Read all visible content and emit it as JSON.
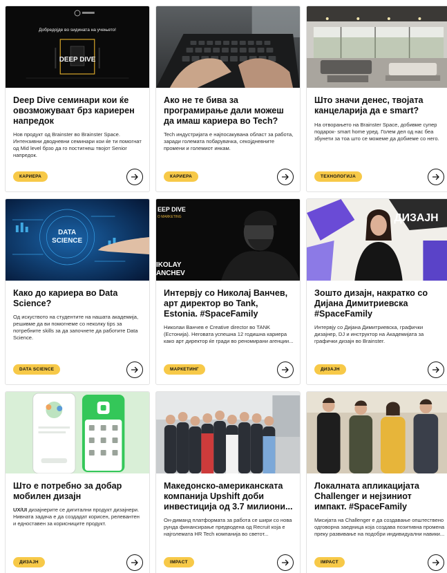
{
  "cards": [
    {
      "title": "Deep Dive семинари кои ќе овозможуваат брз кариерен напредок",
      "desc": "Нов продукт од Brainster во Brainster Space. Интензивни дводневни семинари кои ќе ти помогнат од Mid level брзо да го постигнеш твојот Senior напредок.",
      "badge": "КАРИЕРА",
      "image_text": {
        "welcome": "Добредојде во ѕидината на учењето!",
        "logo": "DEEP DIVE"
      }
    },
    {
      "title": "Ако не те бива за програмирање дали можеш да имаш кариера во Tech?",
      "desc": "Tech индустријата е најпосакувана област за работа, заради големата побарувачка, секојдневните промени и големиот инкам.",
      "badge": "КАРИЕРА"
    },
    {
      "title": "Што значи денес, твојата канцеларија да е smart?",
      "desc": "На отворањето на Brainster Space, добивме супер подарок- smart home уред. Голем дел од нас беа збунети за тоа што се можеме да добиеме со него.",
      "badge": "ТЕХНОЛОГИЈА"
    },
    {
      "title": "Како до кариера во Data Science?",
      "desc": "Од искуството на студентите на нашата академија, решивме да ви помогнеме со неколку tips за потребните skills за да започнете да работите Data Science.",
      "badge": "DATA SCIENCE",
      "image_text": {
        "line1": "DATA",
        "line2": "SCIENCE"
      }
    },
    {
      "title": "Интервју со Николај Ванчев, арт директор во Tank, Estonia. #SpaceFamily",
      "desc": "Николаи Ванчев е Creative director во TANK (Естонија). Неговата успешна 12 годишна кариера како арт директор ќе гради во реномирани агенции...",
      "badge": "МАРКЕТИНГ",
      "image_text": {
        "top": "EEP DIVE",
        "sub": "O MARKETING",
        "name1": "IKOLAY",
        "name2": "ANCHEV"
      }
    },
    {
      "title": "Зошто дизајн, накратко со Дијана Димитриевска #SpaceFamily",
      "desc": "Интервју со Дијана Димитриевска, графички дизајнер, DJ и инструктор на Академијата за графички дизајн во Brainster.",
      "badge": "ДИЗАЈН",
      "image_text": {
        "word": "ДИЗАЈН"
      }
    },
    {
      "title": "Што е потребно за добар мобилен дизајн",
      "desc_strong": "UX/UI",
      "desc": " дизајнерите се дигитални продукт дизајнери. Нивната задача е да создадат корисен, релевантен и едноставен за корисниците продукт.",
      "badge": "ДИЗАЈН"
    },
    {
      "title": "Македонско-американската компанија Upshift доби инвестиција од 3.7 милиони...",
      "desc": "Он-диманд платформата за работа се шири со нова рунда финансирање предводена од Recruit која е најголемата HR Tech компанија во светот...",
      "badge": "IMPACT"
    },
    {
      "title": "Локалната апликацијата Challenger и нејзиниот импакт. #SpaceFamily",
      "desc": "Мисијата на Challenger е да создавање општествено одговорна заедница која создава позитивна промена преку развивање на подобри индивидуални навики...",
      "badge": "IMPACT"
    }
  ]
}
